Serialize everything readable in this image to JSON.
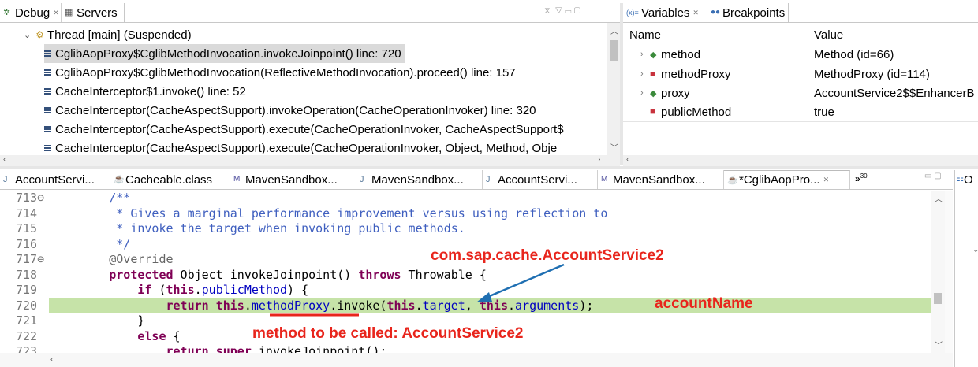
{
  "debug_view": {
    "tabs": [
      {
        "label": "Debug"
      },
      {
        "label": "Servers"
      }
    ],
    "thread_label": "Thread [main] (Suspended)",
    "frames": [
      "CglibAopProxy$CglibMethodInvocation.invokeJoinpoint() line: 720",
      "CglibAopProxy$CglibMethodInvocation(ReflectiveMethodInvocation).proceed() line: 157",
      "CacheInterceptor$1.invoke() line: 52",
      "CacheInterceptor(CacheAspectSupport).invokeOperation(CacheOperationInvoker) line: 320",
      "CacheInterceptor(CacheAspectSupport).execute(CacheOperationInvoker, CacheAspectSupport$",
      "CacheInterceptor(CacheAspectSupport).execute(CacheOperationInvoker, Object, Method, Obje"
    ],
    "selected_frame": 0
  },
  "variables_view": {
    "tabs": [
      {
        "label": "Variables"
      },
      {
        "label": "Breakpoints"
      }
    ],
    "columns": {
      "name": "Name",
      "value": "Value"
    },
    "rows": [
      {
        "name": "method",
        "value": "Method  (id=66)",
        "expandable": true,
        "icon": "field-green-icon"
      },
      {
        "name": "methodProxy",
        "value": "MethodProxy  (id=114)",
        "expandable": true,
        "icon": "field-red-icon"
      },
      {
        "name": "proxy",
        "value": "AccountService2$$EnhancerB",
        "expandable": true,
        "icon": "field-green-icon"
      },
      {
        "name": "publicMethod",
        "value": "true",
        "expandable": false,
        "icon": "field-red-icon"
      }
    ]
  },
  "editor": {
    "tabs": [
      {
        "label": "AccountServi...",
        "icon": "java-file-icon"
      },
      {
        "label": "Cacheable.class",
        "icon": "class-file-icon"
      },
      {
        "label": "MavenSandbox...",
        "icon": "maven-icon"
      },
      {
        "label": "MavenSandbox...",
        "icon": "java-file-icon"
      },
      {
        "label": "AccountServi...",
        "icon": "java-file-icon"
      },
      {
        "label": "MavenSandbox...",
        "icon": "maven-icon"
      },
      {
        "label": "*CglibAopPro...",
        "icon": "class-file-icon",
        "active": true
      }
    ],
    "overflow_count": "30",
    "side_label": "O",
    "lines": [
      {
        "num": "713",
        "fold": "⊖",
        "tokens": [
          {
            "t": "        "
          },
          {
            "t": "/**",
            "c": "cm"
          }
        ]
      },
      {
        "num": "714",
        "tokens": [
          {
            "t": "         "
          },
          {
            "t": "* Gives a marginal performance improvement versus using reflection to",
            "c": "cm"
          }
        ]
      },
      {
        "num": "715",
        "tokens": [
          {
            "t": "         "
          },
          {
            "t": "* invoke the target when invoking public methods.",
            "c": "cm"
          }
        ]
      },
      {
        "num": "716",
        "tokens": [
          {
            "t": "         "
          },
          {
            "t": "*/",
            "c": "cm"
          }
        ]
      },
      {
        "num": "717",
        "fold": "⊖",
        "tokens": [
          {
            "t": "        "
          },
          {
            "t": "@Override",
            "c": "ann"
          }
        ]
      },
      {
        "num": "718",
        "tokens": [
          {
            "t": "        "
          },
          {
            "t": "protected",
            "c": "kw"
          },
          {
            "t": " Object invokeJoinpoint() "
          },
          {
            "t": "throws",
            "c": "kw"
          },
          {
            "t": " Throwable {"
          }
        ]
      },
      {
        "num": "719",
        "tokens": [
          {
            "t": "            "
          },
          {
            "t": "if",
            "c": "kw"
          },
          {
            "t": " ("
          },
          {
            "t": "this",
            "c": "kw"
          },
          {
            "t": "."
          },
          {
            "t": "publicMethod",
            "c": "fld"
          },
          {
            "t": ") {"
          }
        ]
      },
      {
        "num": "720",
        "highlight": true,
        "tokens": [
          {
            "t": "                "
          },
          {
            "t": "return",
            "c": "kw"
          },
          {
            "t": " "
          },
          {
            "t": "this",
            "c": "kw"
          },
          {
            "t": "."
          },
          {
            "t": "methodProxy",
            "c": "fld"
          },
          {
            "t": ".invoke("
          },
          {
            "t": "this",
            "c": "kw"
          },
          {
            "t": "."
          },
          {
            "t": "target",
            "c": "fld"
          },
          {
            "t": ", "
          },
          {
            "t": "this",
            "c": "kw"
          },
          {
            "t": "."
          },
          {
            "t": "arguments",
            "c": "fld"
          },
          {
            "t": ");"
          }
        ]
      },
      {
        "num": "721",
        "tokens": [
          {
            "t": "            }"
          }
        ]
      },
      {
        "num": "722",
        "tokens": [
          {
            "t": "            "
          },
          {
            "t": "else",
            "c": "kw"
          },
          {
            "t": " {"
          }
        ]
      },
      {
        "num": "723",
        "tokens": [
          {
            "t": "                "
          },
          {
            "t": "return",
            "c": "kw"
          },
          {
            "t": " "
          },
          {
            "t": "super",
            "c": "kw"
          },
          {
            "t": ".invokeJoinpoint();"
          }
        ]
      }
    ]
  },
  "annotations": {
    "class_label": "com.sap.cache.AccountService2",
    "arg_label": "accountName",
    "method_label": "method to be called: AccountService2"
  },
  "colors": {
    "highlight": "#c6e3a8",
    "annotation": "#e8251c",
    "arrow": "#1f6fb2"
  }
}
